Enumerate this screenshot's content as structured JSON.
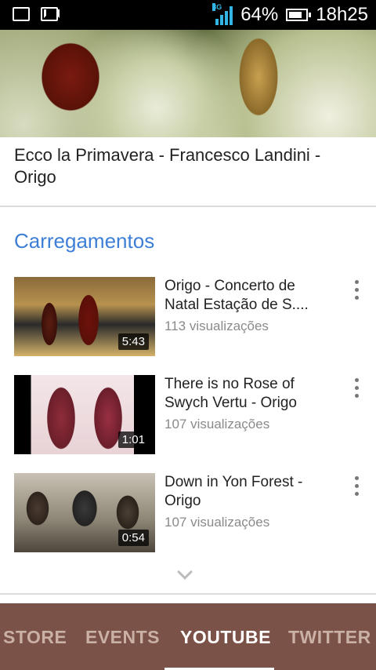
{
  "status_bar": {
    "network_label": "3G",
    "battery_percent": "64%",
    "time": "18h25",
    "icons": [
      "gallery-icon",
      "mail-icon",
      "signal-icon",
      "battery-icon"
    ]
  },
  "video": {
    "title": "Ecco la Primavera - Francesco Landini - Origo"
  },
  "uploads": {
    "section_title": "Carregamentos",
    "items": [
      {
        "title": "Origo - Concerto de Natal Estação de S....",
        "views": "113 visualizações",
        "duration": "5:43"
      },
      {
        "title": "There is no Rose of Swych Vertu - Origo",
        "views": "107 visualizações",
        "duration": "1:01"
      },
      {
        "title": "Down in Yon Forest - Origo",
        "views": "107 visualizações",
        "duration": "0:54"
      }
    ]
  },
  "tabs": {
    "items": [
      "STORE",
      "EVENTS",
      "YOUTUBE",
      "TWITTER"
    ],
    "active": "YOUTUBE"
  },
  "colors": {
    "accent_blue": "#3d7fd6",
    "tab_bar": "#7a5247",
    "signal": "#33b5e5"
  }
}
